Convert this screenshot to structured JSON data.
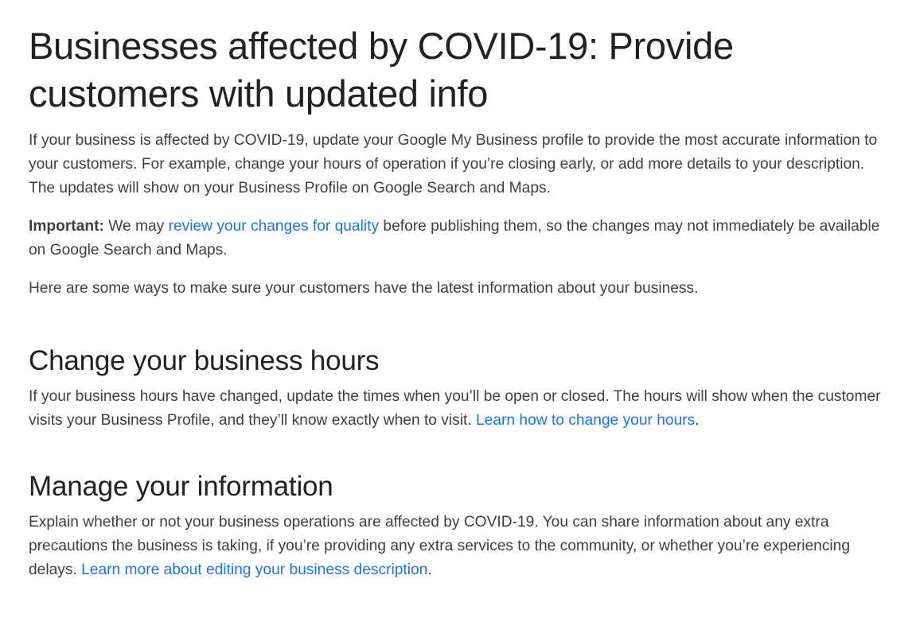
{
  "article": {
    "title": "Businesses affected by COVID-19: Provide customers with updated info",
    "intro": "If your business is affected by COVID-19, update your Google My Business profile to provide the most accurate information to your customers. For example, change your hours of operation if you’re closing early, or add more details to your description. The updates will show on your Business Profile on Google Search and Maps.",
    "important": {
      "label": "Important:",
      "text_before": " We may ",
      "link": "review your changes for quality",
      "text_after": " before publishing them, so the changes may not immediately be available on Google Search and Maps."
    },
    "ways": "Here are some ways to make sure your customers have the latest information about your business."
  },
  "sections": [
    {
      "heading": "Change your business hours",
      "text": "If your business hours have changed, update the times when you’ll be open or closed. The hours will show when the customer visits your Business Profile, and they’ll know exactly when to visit. ",
      "link": "Learn how to change your hours",
      "after": "."
    },
    {
      "heading": "Manage your information",
      "text": "Explain whether or not your business operations are affected by COVID-19. You can share information about any extra precautions the business is taking, if you’re providing any extra services to the community, or whether you’re experiencing delays. ",
      "link": "Learn more about editing your business description",
      "after": "."
    }
  ],
  "colors": {
    "heading": "#202124",
    "body": "#3c4043",
    "link": "#1a73e8"
  }
}
